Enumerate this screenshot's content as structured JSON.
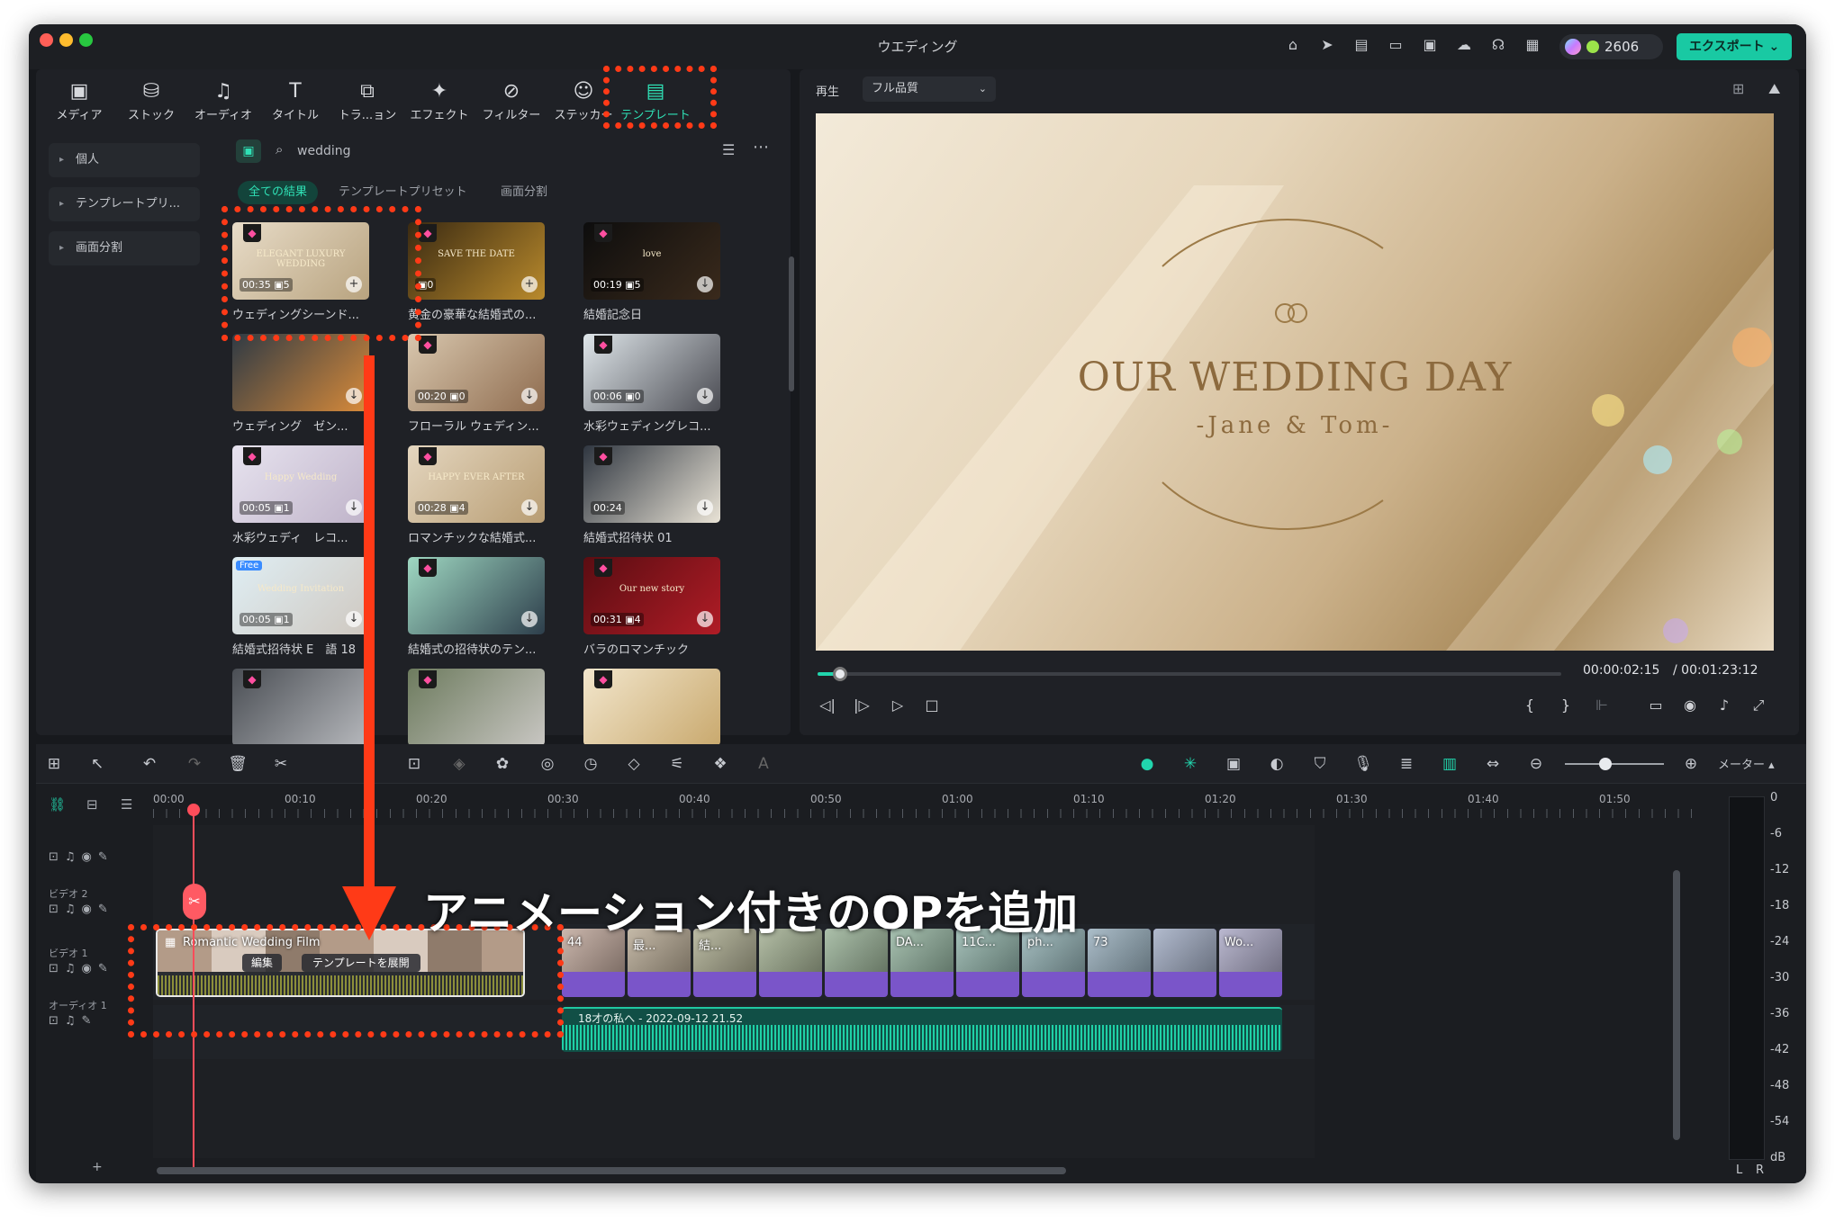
{
  "window": {
    "title": "ウエディング"
  },
  "header": {
    "credits": "2606",
    "export_label": "エクスポート"
  },
  "toolbar": {
    "tabs": [
      {
        "label": "メディア",
        "icon": "media-icon"
      },
      {
        "label": "ストック",
        "icon": "stock-icon"
      },
      {
        "label": "オーディオ",
        "icon": "audio-icon"
      },
      {
        "label": "タイトル",
        "icon": "title-icon"
      },
      {
        "label": "トラ...ョン",
        "icon": "transition-icon"
      },
      {
        "label": "エフェクト",
        "icon": "effect-icon"
      },
      {
        "label": "フィルター",
        "icon": "filter-icon"
      },
      {
        "label": "ステッカー",
        "icon": "sticker-icon"
      },
      {
        "label": "テンプレート",
        "icon": "template-icon",
        "active": true
      }
    ]
  },
  "sidebar": {
    "items": [
      {
        "label": "個人"
      },
      {
        "label": "テンプレートプリ..."
      },
      {
        "label": "画面分割"
      }
    ]
  },
  "search": {
    "query": "wedding"
  },
  "filter_tabs": [
    {
      "label": "全ての結果",
      "active": true
    },
    {
      "label": "テンプレートプリセット"
    },
    {
      "label": "画面分割"
    }
  ],
  "templates": [
    {
      "title": "ウェディングシーンド...",
      "duration": "00:35",
      "count": "5",
      "thumb_text": "ELEGANT LUXURY WEDDING"
    },
    {
      "title": "黄金の豪華な結婚式の...",
      "duration": "",
      "count": "0",
      "thumb_text": "SAVE THE DATE"
    },
    {
      "title": "結婚記念日",
      "duration": "00:19",
      "count": "5",
      "thumb_text": "love"
    },
    {
      "title": "ウェディング　ゼン...",
      "duration": "",
      "count": "",
      "thumb_text": ""
    },
    {
      "title": "フローラル ウェディン...",
      "duration": "00:20",
      "count": "0",
      "thumb_text": ""
    },
    {
      "title": "水彩ウェディングレコ...",
      "duration": "00:06",
      "count": "0",
      "thumb_text": ""
    },
    {
      "title": "水彩ウェディ　レコ...",
      "duration": "00:05",
      "count": "1",
      "thumb_text": "Happy Wedding"
    },
    {
      "title": "ロマンチックな結婚式...",
      "duration": "00:28",
      "count": "4",
      "thumb_text": "HAPPY EVER AFTER"
    },
    {
      "title": "結婚式招待状 01",
      "duration": "00:24",
      "count": "",
      "thumb_text": ""
    },
    {
      "title": "結婚式招待状 E　語 18",
      "duration": "00:05",
      "count": "1",
      "thumb_text": "Wedding Invitation",
      "badge": "Free"
    },
    {
      "title": "結婚式の招待状のテン...",
      "duration": "",
      "count": "",
      "thumb_text": ""
    },
    {
      "title": "バラのロマンチック",
      "duration": "00:31",
      "count": "4",
      "thumb_text": "Our new story"
    },
    {
      "title": "",
      "duration": "",
      "count": "",
      "thumb_text": ""
    },
    {
      "title": "",
      "duration": "",
      "count": "",
      "thumb_text": ""
    },
    {
      "title": "",
      "duration": "",
      "count": "",
      "thumb_text": ""
    }
  ],
  "player": {
    "play_label": "再生",
    "quality": "フル品質",
    "preview_title": "OUR WEDDING DAY",
    "preview_subtitle": "-Jane & Tom-",
    "current_time": "00:00:02:15",
    "total_time": "/ 00:01:23:12",
    "progress": 0.03
  },
  "timeline": {
    "meter_label": "メーター",
    "ruler": [
      "00:00",
      "00:10",
      "00:20",
      "00:30",
      "00:40",
      "00:50",
      "01:00",
      "01:10",
      "01:20",
      "01:30",
      "01:40",
      "01:50"
    ],
    "tracks": [
      "ビデオ 2",
      "ビデオ 1",
      "オーディオ 1"
    ],
    "op_clip": {
      "name": "Romantic Wedding Film",
      "edit_label": "編集",
      "expand_label": "テンプレートを展開"
    },
    "video_clips": [
      "44",
      "最...",
      "結...",
      "",
      "",
      "DA...",
      "11C...",
      "ph...",
      "73",
      "",
      "Wo..."
    ],
    "audio_clip": "18才の私へ - 2022-09-12 21.52",
    "meter_scale": [
      "0",
      "-6",
      "-12",
      "-18",
      "-24",
      "-30",
      "-36",
      "-42",
      "-48",
      "-54",
      "dB"
    ],
    "meter_channels": [
      "L",
      "R"
    ]
  },
  "annotation": {
    "text": "アニメーション付きのOPを追加"
  },
  "colors": {
    "accent": "#19c9a3",
    "annotation": "#ff3a17",
    "playhead": "#ff4d5a",
    "clip_video": "#7a55c9",
    "clip_audio": "#114f46"
  }
}
